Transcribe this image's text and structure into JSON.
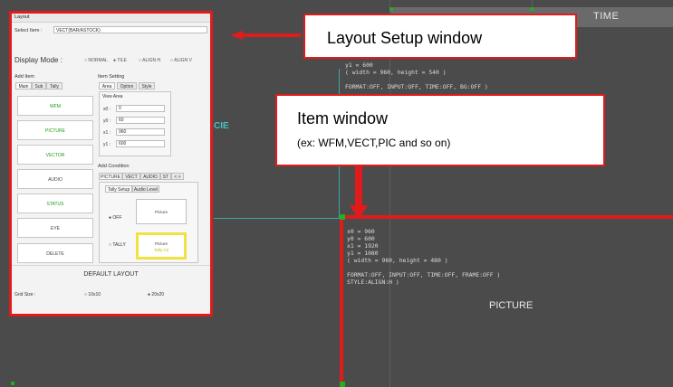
{
  "background": {
    "time_label": "TIME",
    "cie_label": "CIE",
    "picture_label": "PICTURE",
    "upper_info": "y1 = 600\n( width = 960, height = 540 )\n\nFORMAT:OFF, INPUT:OFF, TIME:OFF, BG:OFF )",
    "lower_info": "x0 = 960\ny0 = 600\nx1 = 1920\ny1 = 1080\n( width = 960, height = 480 )\n\nFORMAT:OFF, INPUT:OFF, TIME:OFF, FRAME:OFF )\nSTYLE:ALIGN:H )"
  },
  "layout_window": {
    "title": "Layout",
    "select_item_label": "Select Item :",
    "select_item_value": "VECT(BAR/ASTOCK)",
    "display_mode_label": "Display Mode :",
    "display_modes": [
      "NORMAL",
      "TILE",
      "ALIGN H",
      "ALIGN V"
    ],
    "add_item_label": "Add Item",
    "add_item_tabs": [
      "Main",
      "Sub",
      "Tally"
    ],
    "items": [
      "WFM",
      "PICTURE",
      "VECTOR",
      "AUDIO",
      "STATUS",
      "EYE"
    ],
    "delete_label": "DELETE",
    "item_setting_label": "Item Setting",
    "item_setting_tabs": [
      "Area",
      "Option",
      "Style"
    ],
    "view_area_label": "View Area",
    "coords": [
      {
        "label": "x0 :",
        "value": "0"
      },
      {
        "label": "y0 :",
        "value": "60"
      },
      {
        "label": "x1 :",
        "value": "960"
      },
      {
        "label": "y1 :",
        "value": "600"
      }
    ],
    "add_condition_label": "Add Condition",
    "condition_tabs": [
      "PICTURE",
      "VECT",
      "AUDIO",
      "ST"
    ],
    "condition_more": "< >",
    "sub_tabs": [
      "Tally Setup",
      "Audio Level"
    ],
    "off_label": "OFF",
    "tally_label": "TALLY",
    "picture_btn": "Picture",
    "picture_tally_btn": "Picture",
    "picture_tally_sub": "Tally Ctl",
    "default_layout": "DEFAULT LAYOUT",
    "grid_size_label": "Grid Size :",
    "grid_options": [
      "10x10",
      "20x20"
    ]
  },
  "callouts": {
    "layout_setup": "Layout Setup window",
    "item_window": "Item window",
    "item_window_sub": "(ex: WFM,VECT,PIC and so on)"
  },
  "colors": {
    "accent_red": "#e01b1b",
    "green": "#1db31d",
    "cyan": "#3aa6a8",
    "item_green": "#1aa01a"
  }
}
